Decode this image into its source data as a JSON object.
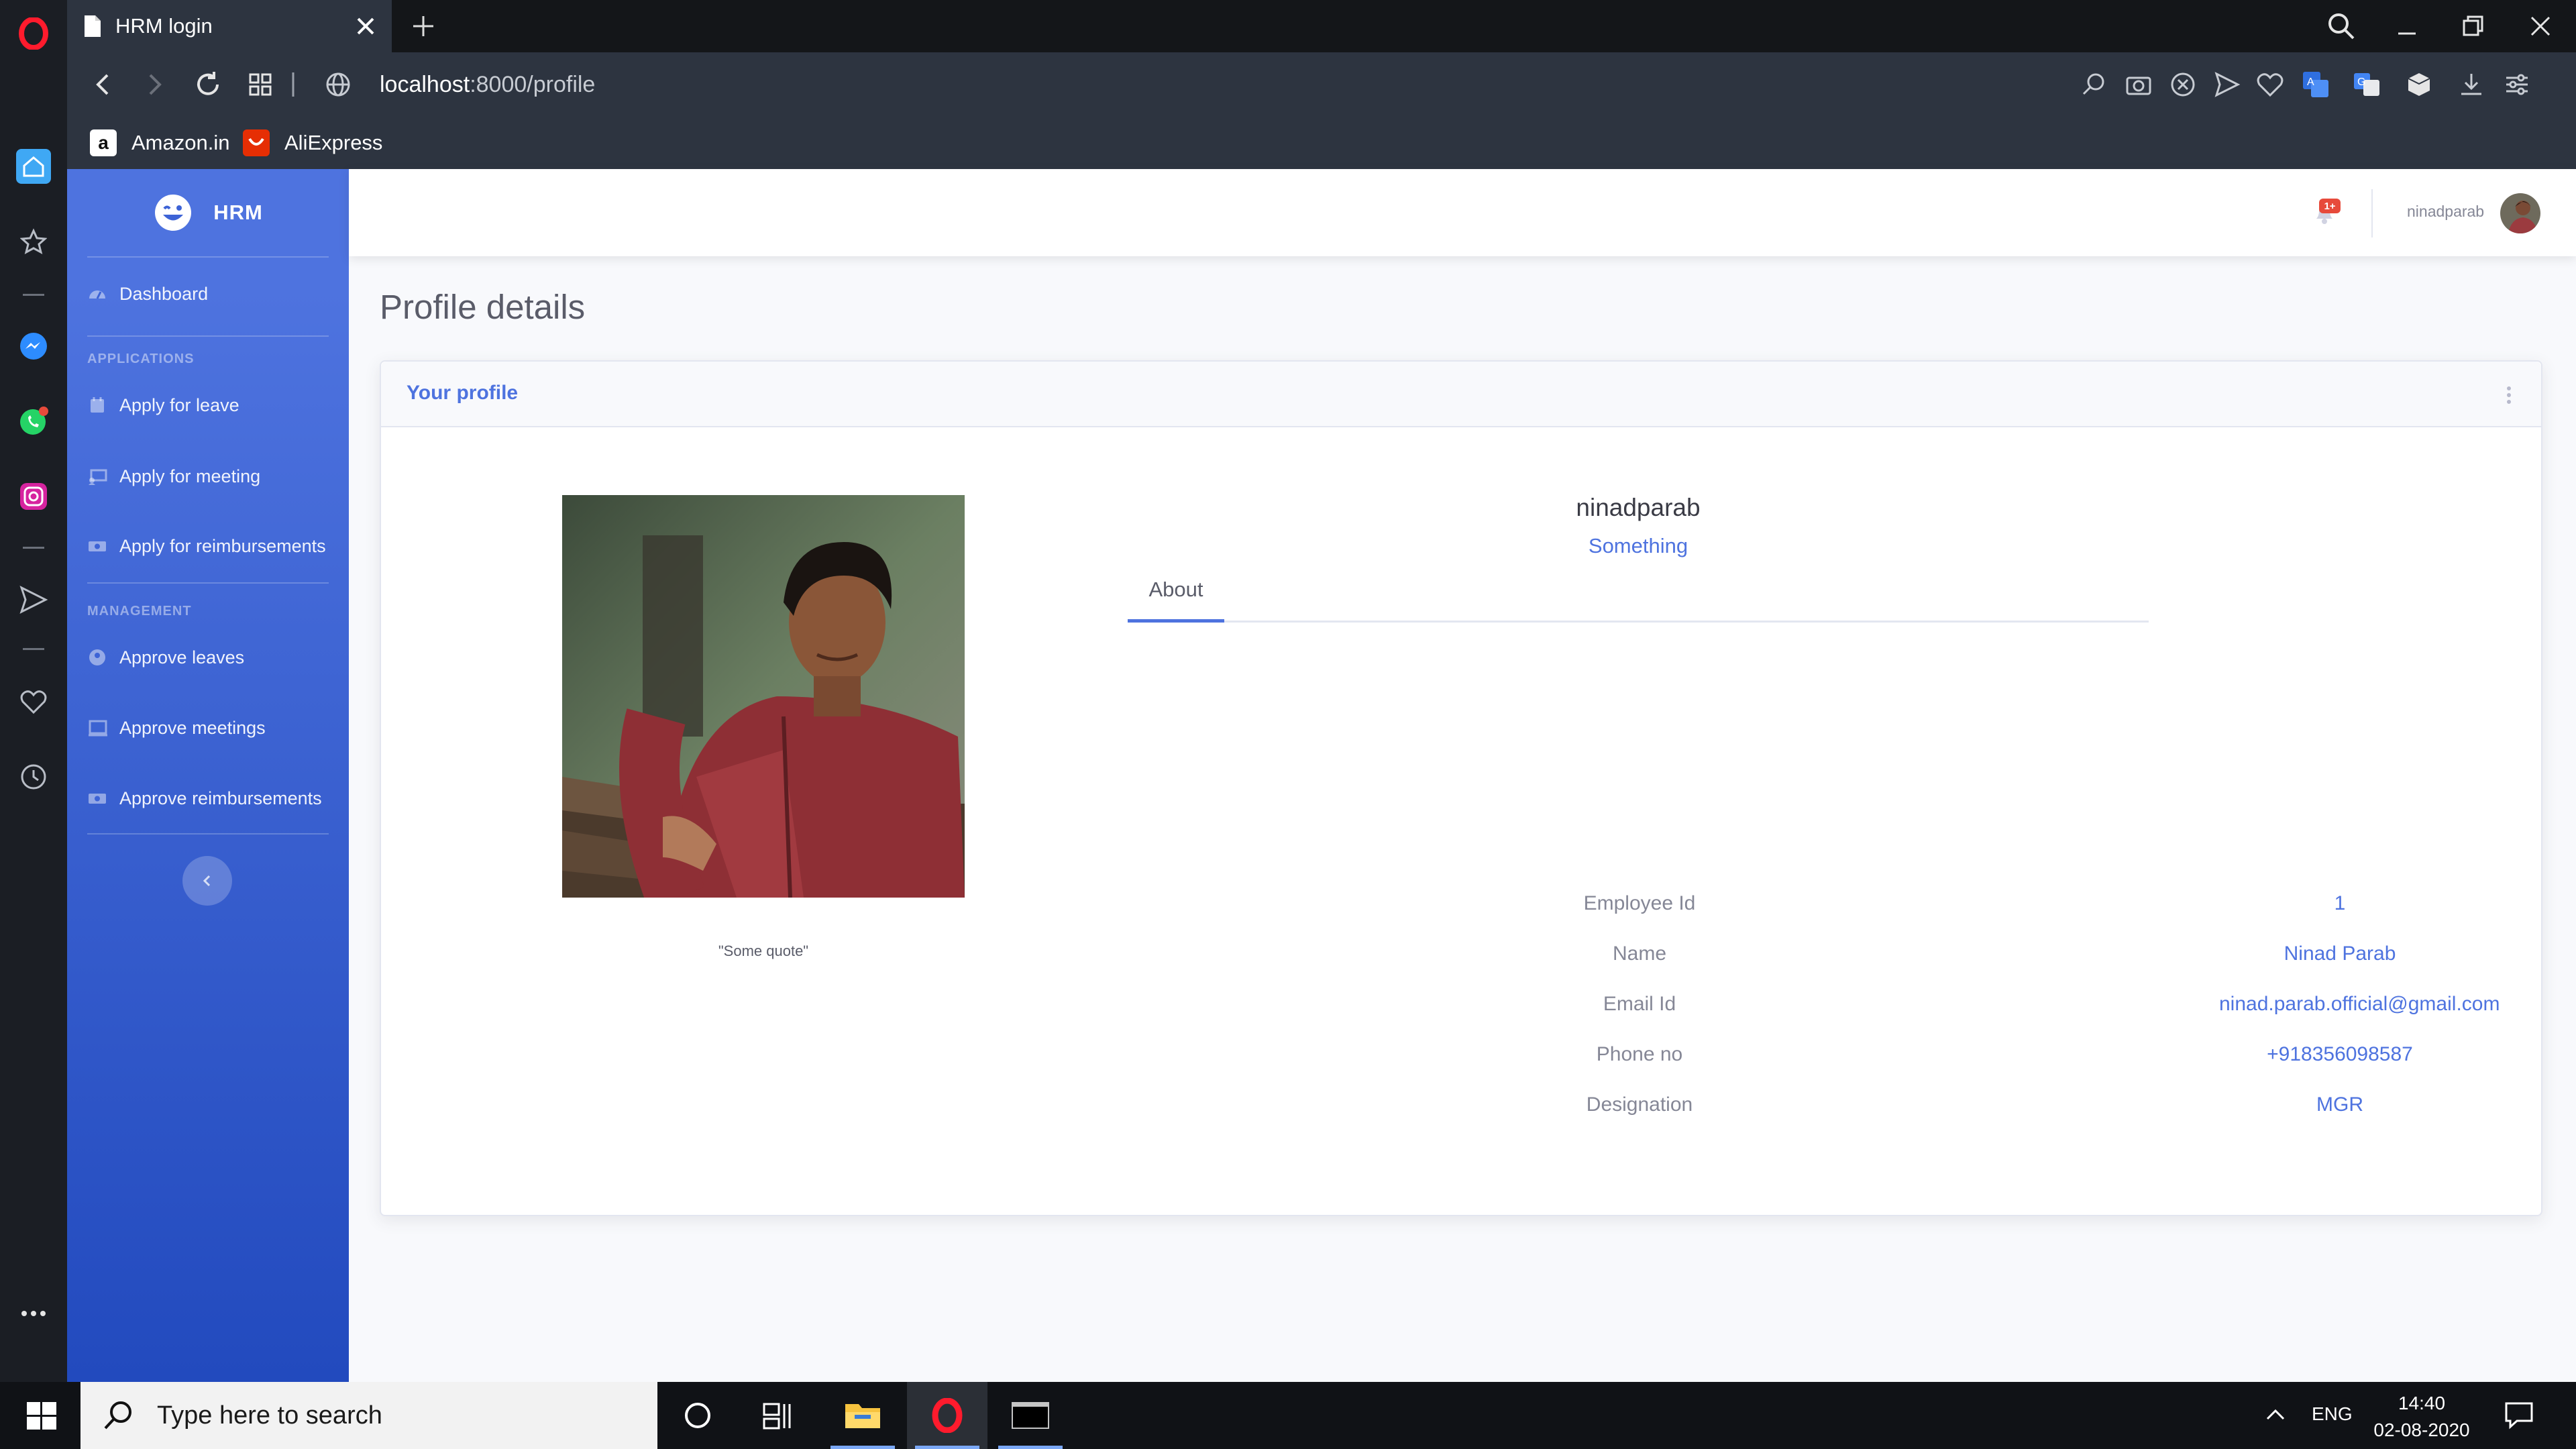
{
  "browser": {
    "tab_title": "HRM login",
    "url_host": "localhost",
    "url_path": ":8000/profile",
    "bookmarks": [
      "Amazon.in",
      "AliExpress"
    ]
  },
  "sidebar": {
    "brand": "HRM",
    "dashboard": "Dashboard",
    "heading_applications": "APPLICATIONS",
    "apply_leave": "Apply for leave",
    "apply_meeting": "Apply for meeting",
    "apply_reimbursements": "Apply for reimbursements",
    "heading_management": "MANAGEMENT",
    "approve_leaves": "Approve leaves",
    "approve_meetings": "Approve meetings",
    "approve_reimbursements": "Approve reimbursements"
  },
  "topbar": {
    "notification_badge": "1+",
    "username": "ninadparab"
  },
  "page": {
    "title": "Profile details",
    "card_title": "Your profile",
    "quote": "\"Some quote\"",
    "username": "ninadparab",
    "subtitle": "Something",
    "tab_about": "About"
  },
  "profile": {
    "labels": {
      "employee_id": "Employee Id",
      "name": "Name",
      "email": "Email Id",
      "phone": "Phone no",
      "designation": "Designation"
    },
    "values": {
      "employee_id": "1",
      "name": "Ninad Parab",
      "email": "ninad.parab.official@gmail.com",
      "phone": "+918356098587",
      "designation": "MGR"
    }
  },
  "taskbar": {
    "search_placeholder": "Type here to search",
    "language": "ENG",
    "time": "14:40",
    "date": "02-08-2020"
  },
  "colors": {
    "primary": "#4e73df",
    "sidebar_gradient_end": "#224abe",
    "danger": "#e74a3b",
    "opera_red": "#ff1b2d"
  }
}
